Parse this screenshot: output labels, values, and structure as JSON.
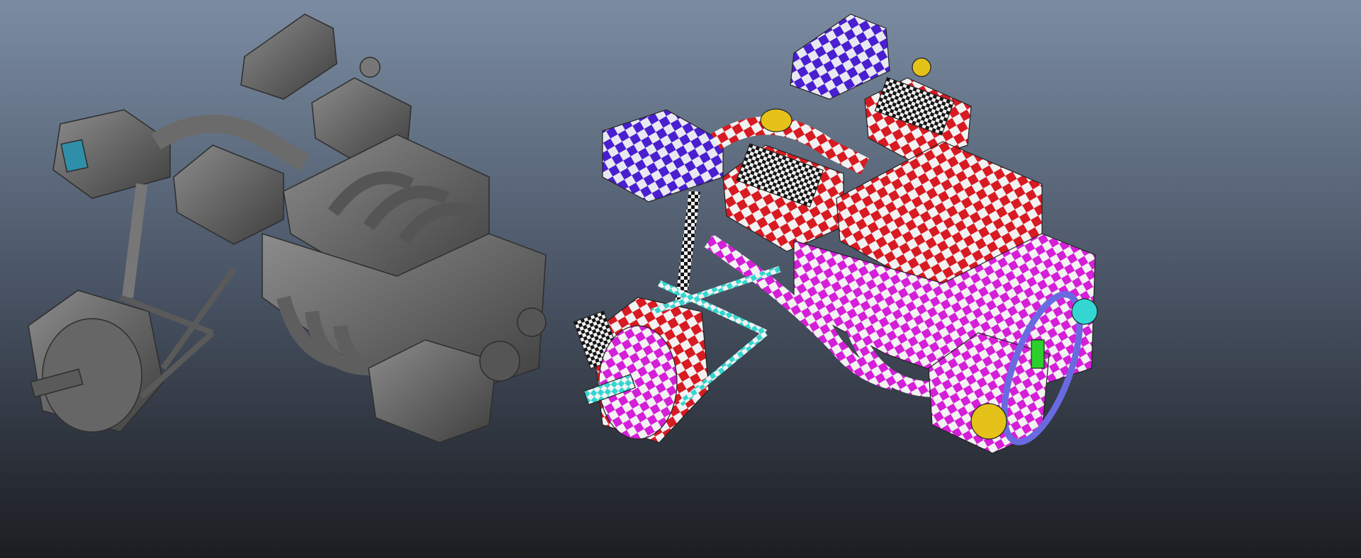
{
  "viewport": {
    "background_top": "#7b8ca2",
    "background_mid": "#4a5566",
    "background_bottom": "#1b1d21"
  },
  "models": {
    "shaded": {
      "base": "#6b6b6b",
      "light": "#8c8c8c",
      "dark": "#3e3e3e",
      "accent": "#2f8fa8"
    },
    "uv_checker": {
      "airbox": "#4a1fd0",
      "plenum": "#d81a22",
      "manifold": "#d51fd8",
      "suspension": "#33d6d0",
      "pulley": "#e4c21a",
      "belt": "#6a6ae0",
      "misc_green": "#2ccf2c",
      "white": "#f2f2f2",
      "black": "#151515"
    }
  }
}
